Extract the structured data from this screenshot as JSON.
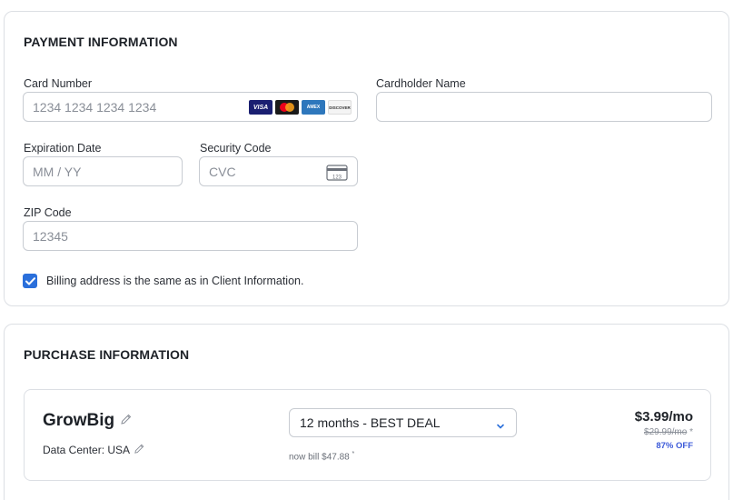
{
  "payment": {
    "title": "PAYMENT INFORMATION",
    "card_number": {
      "label": "Card Number",
      "placeholder": "1234 1234 1234 1234",
      "brands": [
        "VISA",
        "mastercard",
        "AMEX",
        "DISCOVER"
      ]
    },
    "cardholder": {
      "label": "Cardholder Name",
      "value": ""
    },
    "expiration": {
      "label": "Expiration Date",
      "placeholder": "MM / YY"
    },
    "security": {
      "label": "Security Code",
      "placeholder": "CVC",
      "icon_text": "123"
    },
    "zip": {
      "label": "ZIP Code",
      "placeholder": "12345"
    },
    "billing_checkbox": {
      "checked": true,
      "label": "Billing address is the same as in Client Information."
    }
  },
  "purchase": {
    "title": "PURCHASE INFORMATION",
    "plan": {
      "name": "GrowBig",
      "datacenter": "Data Center: USA",
      "period_selected": "12 months - BEST DEAL",
      "bill_note": "now bill $47.88",
      "bill_note_mark": "*",
      "price": "$3.99/mo",
      "old_price": "$29.99/mo",
      "old_price_mark": "*",
      "discount": "87% OFF"
    }
  },
  "colors": {
    "accent": "#2a6fdb",
    "discount": "#3d5bd9",
    "border": "#dcdfe4"
  }
}
